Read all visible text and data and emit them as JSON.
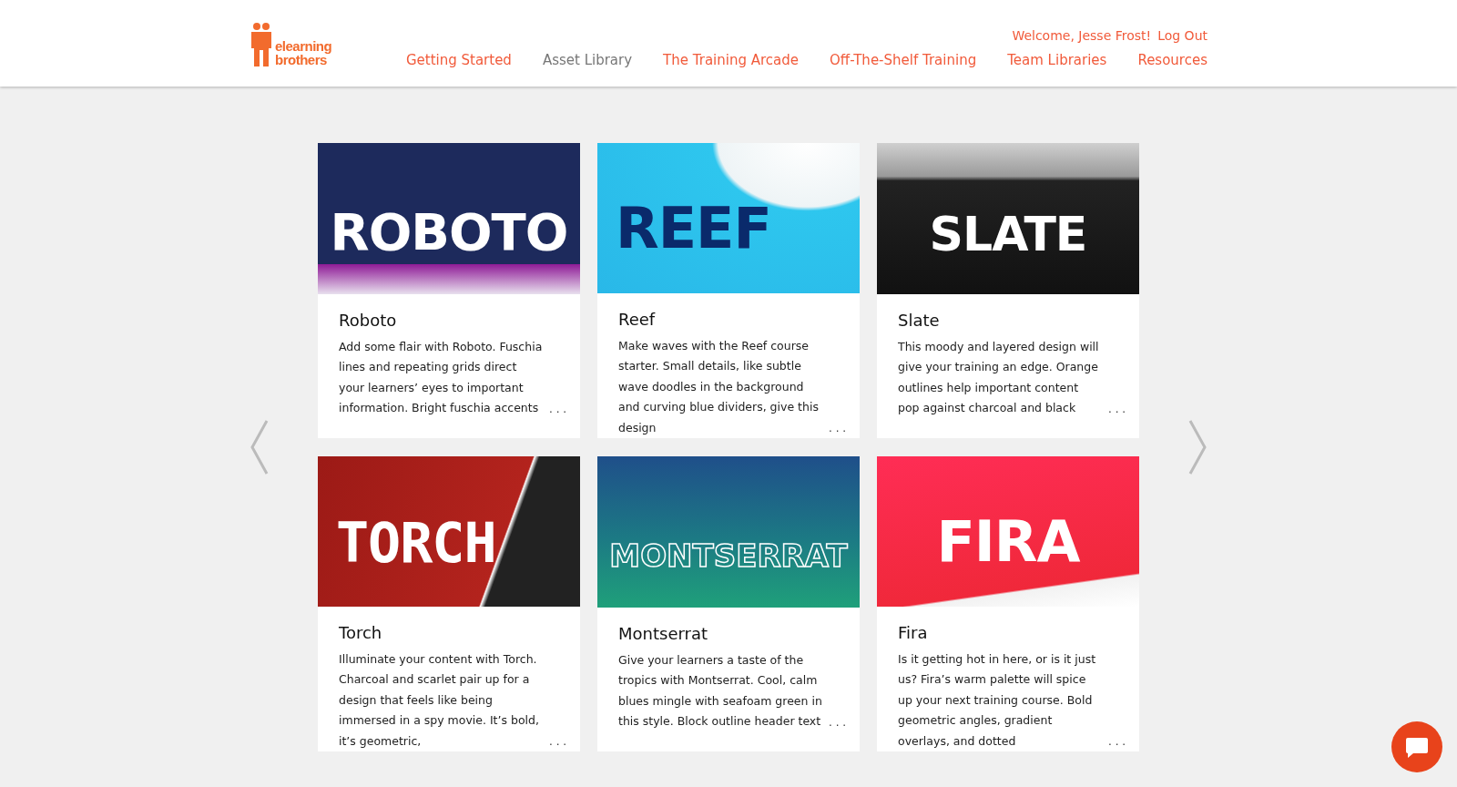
{
  "header": {
    "logo": {
      "line_1": "elearning",
      "line_2": "brothers"
    },
    "welcome": "Welcome, Jesse Frost!",
    "logout": "Log Out",
    "nav": [
      {
        "label": "Getting Started",
        "selected": false
      },
      {
        "label": "Asset Library",
        "selected": true
      },
      {
        "label": "The Training Arcade",
        "selected": false
      },
      {
        "label": "Off-The-Shelf Training",
        "selected": false
      },
      {
        "label": "Team Libraries",
        "selected": false
      },
      {
        "label": "Resources",
        "selected": false
      }
    ]
  },
  "cards": [
    {
      "banner": {
        "kind": "roboto",
        "text": "ROBOTO"
      },
      "title": "Roboto",
      "description": "Add some flair with Roboto. Fuschia lines and repeating grids direct your learners’ eyes to important information. Bright fuschia accents",
      "more": ". . ."
    },
    {
      "banner": {
        "kind": "reef",
        "text": "REEF"
      },
      "title": "Reef",
      "description": "Make waves with the Reef course starter. Small details, like subtle wave doodles in the background and curving blue dividers, give this design",
      "more": ". . ."
    },
    {
      "banner": {
        "kind": "slate",
        "text": "SLATE"
      },
      "title": "Slate",
      "description": "This moody and layered design will give your training an edge. Orange outlines help important content pop against charcoal and black",
      "more": ". . ."
    },
    {
      "banner": {
        "kind": "torch",
        "text": "TORCH"
      },
      "title": "Torch",
      "description": "Illuminate your content with Torch. Charcoal and scarlet pair up for a design that feels like being immersed in a spy movie. It’s bold, it’s geometric,",
      "more": ". . ."
    },
    {
      "banner": {
        "kind": "montserrat",
        "text": "MONTSERRAT"
      },
      "title": "Montserrat",
      "description": "Give your learners a taste of the tropics with Montserrat. Cool, calm blues mingle with seafoam green in this style. Block outline header text",
      "more": ". . ."
    },
    {
      "banner": {
        "kind": "fira",
        "text": "FIRA"
      },
      "title": "Fira",
      "description": "Is it getting hot in here, or is it just us? Fira’s warm palette will spice up your next training course. Bold geometric angles, gradient overlays, and dotted",
      "more": ". . ."
    }
  ]
}
